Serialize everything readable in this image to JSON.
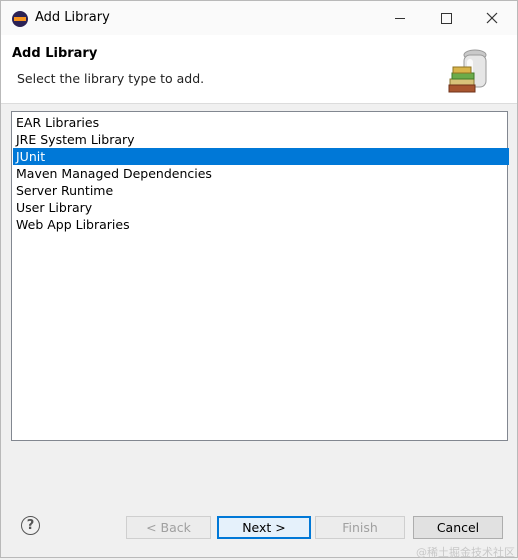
{
  "window": {
    "title": "Add Library"
  },
  "header": {
    "title": "Add Library",
    "description": "Select the library type to add."
  },
  "library_types": [
    {
      "label": "EAR Libraries",
      "selected": false
    },
    {
      "label": "JRE System Library",
      "selected": false
    },
    {
      "label": "JUnit",
      "selected": true
    },
    {
      "label": "Maven Managed Dependencies",
      "selected": false
    },
    {
      "label": "Server Runtime",
      "selected": false
    },
    {
      "label": "User Library",
      "selected": false
    },
    {
      "label": "Web App Libraries",
      "selected": false
    }
  ],
  "buttons": {
    "back": "< Back",
    "next": "Next >",
    "finish": "Finish",
    "cancel": "Cancel",
    "help": "?"
  },
  "watermark": "@稀土掘金技术社区",
  "colors": {
    "selection": "#0078d7",
    "default_button_border": "#0078d7"
  }
}
